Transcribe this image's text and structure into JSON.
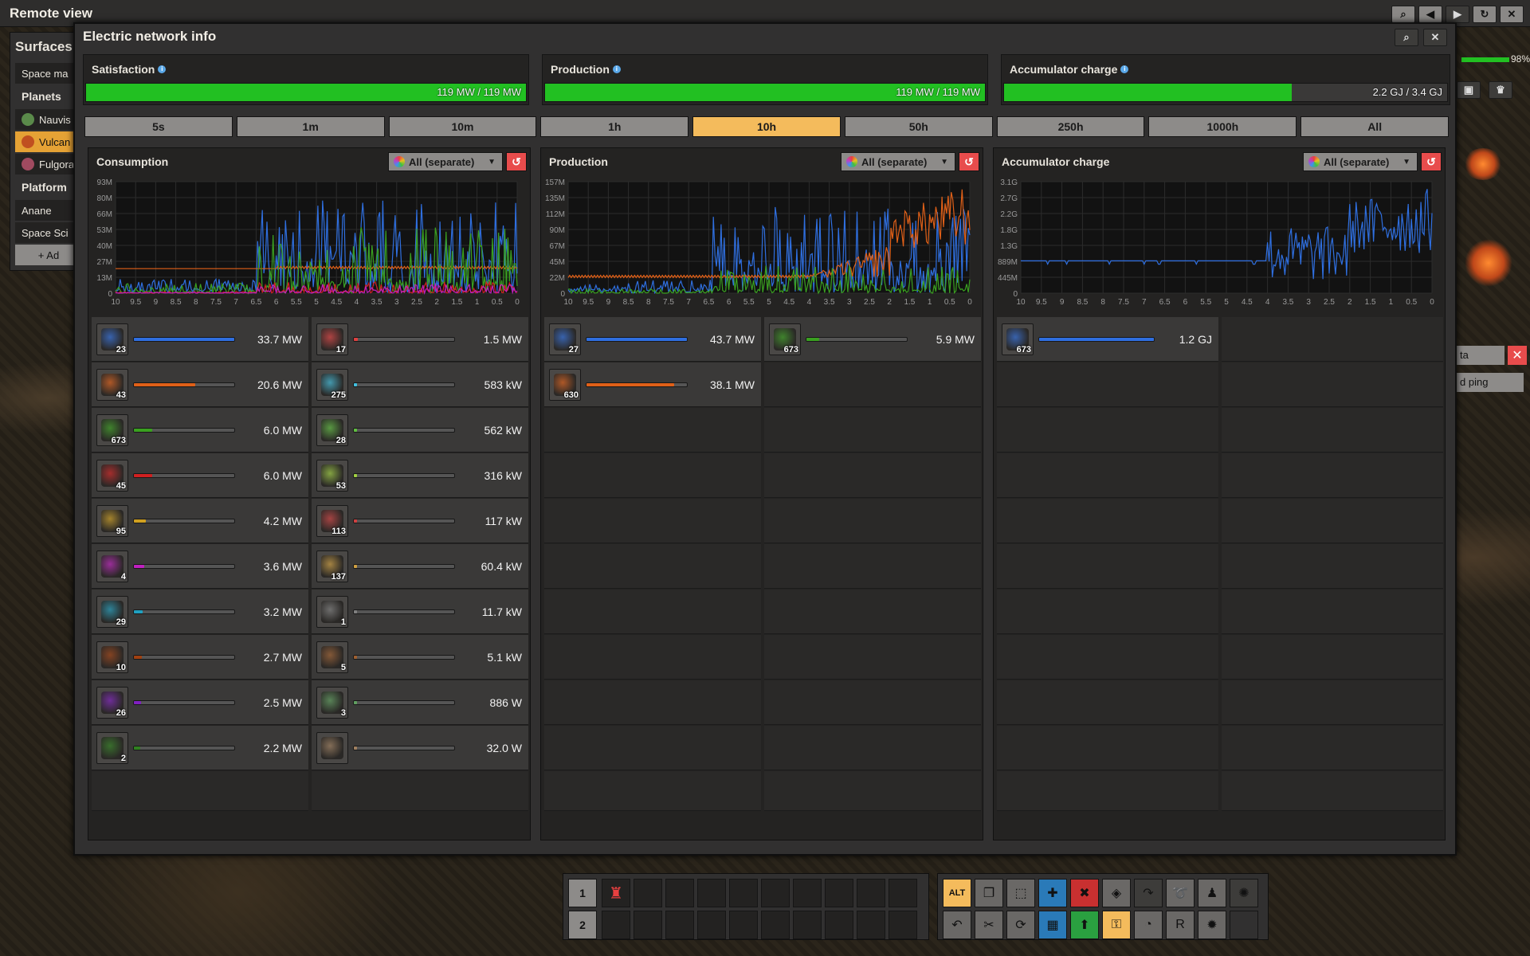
{
  "titlebar": {
    "title": "Remote view"
  },
  "surfaces": {
    "title": "Surfaces",
    "items": [
      "Space ma"
    ],
    "planets_label": "Planets",
    "planets": [
      "Nauvis",
      "Vulcan",
      "Fulgora"
    ],
    "platforms_label": "Platform",
    "platforms": [
      "Anane",
      "Space Sci"
    ],
    "add_label": "+ Ad"
  },
  "right_stub": {
    "pct": "98%",
    "btn1": "ta",
    "btn2": "d ping"
  },
  "window": {
    "title": "Electric network info"
  },
  "summary": [
    {
      "label": "Satisfaction",
      "value": "119 MW / 119 MW",
      "fraction": 1.0
    },
    {
      "label": "Production",
      "value": "119 MW / 119 MW",
      "fraction": 1.0
    },
    {
      "label": "Accumulator charge",
      "value": "2.2 GJ / 3.4 GJ",
      "fraction": 0.65
    }
  ],
  "tabs": [
    "5s",
    "1m",
    "10m",
    "1h",
    "10h",
    "50h",
    "250h",
    "1000h",
    "All"
  ],
  "active_tab": "10h",
  "dropdown_label": "All (separate)",
  "panels": [
    {
      "title": "Consumption",
      "yticks": [
        "93M",
        "80M",
        "66M",
        "53M",
        "40M",
        "27M",
        "13M",
        "0"
      ],
      "xticks": [
        "10",
        "9.5",
        "9",
        "8.5",
        "8",
        "7.5",
        "7",
        "6.5",
        "6",
        "5.5",
        "5",
        "4.5",
        "4",
        "3.5",
        "3",
        "2.5",
        "2",
        "1.5",
        "1",
        "0.5",
        "0"
      ]
    },
    {
      "title": "Production",
      "yticks": [
        "157M",
        "135M",
        "112M",
        "90M",
        "67M",
        "45M",
        "22M",
        "0"
      ],
      "xticks": [
        "10",
        "9.5",
        "9",
        "8.5",
        "8",
        "7.5",
        "7",
        "6.5",
        "6",
        "5.5",
        "5",
        "4.5",
        "4",
        "3.5",
        "3",
        "2.5",
        "2",
        "1.5",
        "1",
        "0.5",
        "0"
      ]
    },
    {
      "title": "Accumulator charge",
      "yticks": [
        "3.1G",
        "2.7G",
        "2.2G",
        "1.8G",
        "1.3G",
        "889M",
        "445M",
        "0"
      ],
      "xticks": [
        "10",
        "9.5",
        "9",
        "8.5",
        "8",
        "7.5",
        "7",
        "6.5",
        "6",
        "5.5",
        "5",
        "4.5",
        "4",
        "3.5",
        "3",
        "2.5",
        "2",
        "1.5",
        "1",
        "0.5",
        "0"
      ]
    }
  ],
  "consumption_left": [
    {
      "count": "23",
      "value": "33.7 MW",
      "fraction": 1.0,
      "color": "#2f6fe0",
      "icon": "foundry-icon"
    },
    {
      "count": "43",
      "value": "20.6 MW",
      "fraction": 0.61,
      "color": "#e06018",
      "icon": "big-mining-drill-icon"
    },
    {
      "count": "673",
      "value": "6.0 MW",
      "fraction": 0.18,
      "color": "#3aa020",
      "icon": "accumulator-icon"
    },
    {
      "count": "45",
      "value": "6.0 MW",
      "fraction": 0.18,
      "color": "#d02020",
      "icon": "assembler-icon"
    },
    {
      "count": "95",
      "value": "4.2 MW",
      "fraction": 0.12,
      "color": "#d0a020",
      "icon": "assembler-3-icon"
    },
    {
      "count": "4",
      "value": "3.6 MW",
      "fraction": 0.1,
      "color": "#c020c0",
      "icon": "electromagnetic-plant-icon"
    },
    {
      "count": "29",
      "value": "3.2 MW",
      "fraction": 0.09,
      "color": "#20a0c0",
      "icon": "chemical-plant-icon"
    },
    {
      "count": "10",
      "value": "2.7 MW",
      "fraction": 0.08,
      "color": "#a04010",
      "icon": "recycler-icon"
    },
    {
      "count": "26",
      "value": "2.5 MW",
      "fraction": 0.07,
      "color": "#8020c0",
      "icon": "beacon-icon"
    },
    {
      "count": "2",
      "value": "2.2 MW",
      "fraction": 0.06,
      "color": "#308020",
      "icon": "oil-refinery-icon"
    }
  ],
  "consumption_right": [
    {
      "count": "17",
      "value": "1.5 MW",
      "fraction": 0.04,
      "color": "#e04040",
      "icon": "electric-furnace-icon"
    },
    {
      "count": "275",
      "value": "583 kW",
      "fraction": 0.0,
      "color": "#40c0e0",
      "icon": "inserter-fast-icon"
    },
    {
      "count": "28",
      "value": "562 kW",
      "fraction": 0.0,
      "color": "#60c040",
      "icon": "stack-inserter-icon"
    },
    {
      "count": "53",
      "value": "316 kW",
      "fraction": 0.0,
      "color": "#a0d040",
      "icon": "bulk-inserter-icon"
    },
    {
      "count": "113",
      "value": "117 kW",
      "fraction": 0.0,
      "color": "#d04040",
      "icon": "long-inserter-icon"
    },
    {
      "count": "137",
      "value": "60.4 kW",
      "fraction": 0.0,
      "color": "#d0a040",
      "icon": "inserter-icon"
    },
    {
      "count": "1",
      "value": "11.7 kW",
      "fraction": 0.0,
      "color": "#808080",
      "icon": "roboport-icon"
    },
    {
      "count": "5",
      "value": "5.1 kW",
      "fraction": 0.0,
      "color": "#a06030",
      "icon": "radar-icon"
    },
    {
      "count": "3",
      "value": "886 W",
      "fraction": 0.0,
      "color": "#60a060",
      "icon": "lab-icon"
    },
    {
      "count": "",
      "value": "32.0 W",
      "fraction": 0.0,
      "color": "#a08060",
      "icon": "lamp-icon"
    }
  ],
  "production_left": [
    {
      "count": "27",
      "value": "43.7 MW",
      "fraction": 1.0,
      "color": "#2f6fe0",
      "icon": "steam-turbine-icon"
    },
    {
      "count": "630",
      "value": "38.1 MW",
      "fraction": 0.87,
      "color": "#e06018",
      "icon": "solar-panel-icon"
    }
  ],
  "production_right": [
    {
      "count": "673",
      "value": "5.9 MW",
      "fraction": 0.13,
      "color": "#3aa020",
      "icon": "accumulator-icon"
    }
  ],
  "accumulator_left": [
    {
      "count": "673",
      "value": "1.2 GJ",
      "fraction": 1.0,
      "color": "#2f6fe0",
      "icon": "accumulator-icon"
    }
  ],
  "quickbar": {
    "row1": "1",
    "row2": "2"
  },
  "toolbar": {
    "alt_label": "ALT"
  }
}
